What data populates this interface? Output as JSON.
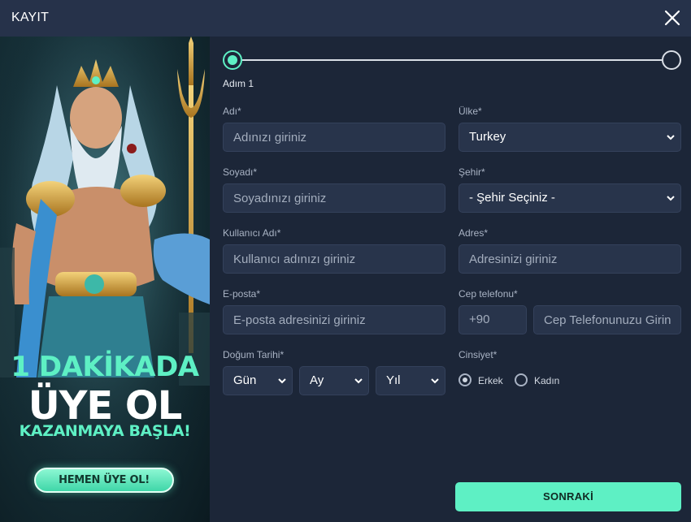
{
  "modal": {
    "title": "KAYIT"
  },
  "banner": {
    "line1": "1 DAKİKADA",
    "line2": "ÜYE OL",
    "line3": "KAZANMAYA BAŞLA!",
    "cta": "HEMEN ÜYE OL!"
  },
  "stepper": {
    "current_label": "Adım 1",
    "current_step": 1,
    "total_steps": 2
  },
  "form": {
    "first_name": {
      "label": "Adı*",
      "placeholder": "Adınızı giriniz"
    },
    "last_name": {
      "label": "Soyadı*",
      "placeholder": "Soyadınızı giriniz"
    },
    "username": {
      "label": "Kullanıcı Adı*",
      "placeholder": "Kullanıcı adınızı giriniz"
    },
    "email": {
      "label": "E-posta*",
      "placeholder": "E-posta adresinizi giriniz"
    },
    "birth_date": {
      "label": "Doğum Tarihi*",
      "day": "Gün",
      "month": "Ay",
      "year": "Yıl"
    },
    "country": {
      "label": "Ülke*",
      "value": "Turkey"
    },
    "city": {
      "label": "Şehir*",
      "value": "- Şehir Seçiniz -"
    },
    "address": {
      "label": "Adres*",
      "placeholder": "Adresinizi giriniz"
    },
    "phone": {
      "label": "Cep telefonu*",
      "code": "+90",
      "placeholder": "Cep Telefonunuzu Giriniz"
    },
    "gender": {
      "label": "Cinsiyet*",
      "options": [
        "Erkek",
        "Kadın"
      ],
      "selected": "Erkek"
    }
  },
  "actions": {
    "next_label": "SONRAKİ"
  },
  "colors": {
    "accent": "#5ef0c4",
    "background": "#1c2638",
    "header": "#26324a",
    "field": "#28344b"
  }
}
